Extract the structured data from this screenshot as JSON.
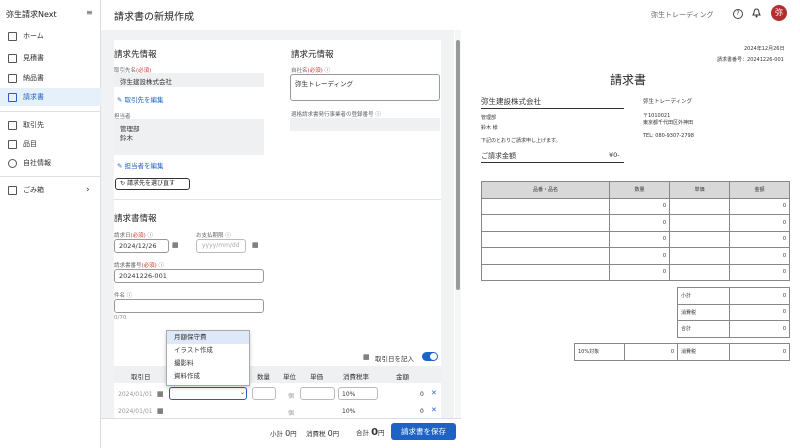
{
  "app": {
    "name": "弥生請求Next",
    "collapse_icon": "≡"
  },
  "sidebar": {
    "items": [
      {
        "label": "ホーム",
        "icon": "home-icon"
      },
      {
        "label": "見積書",
        "icon": "document-icon"
      },
      {
        "label": "納品書",
        "icon": "document-icon"
      },
      {
        "label": "請求書",
        "icon": "document-icon",
        "active": true
      },
      {
        "label": "取引先",
        "icon": "building-icon"
      },
      {
        "label": "品目",
        "icon": "box-icon"
      },
      {
        "label": "自社情報",
        "icon": "gear-icon"
      },
      {
        "label": "ごみ箱",
        "icon": "trash-icon"
      }
    ]
  },
  "header": {
    "title": "請求書の新規作成",
    "company": "弥生トレーディング",
    "avatar": "弥",
    "help": "?",
    "bell": "🔔"
  },
  "client": {
    "section": "請求先情報",
    "name_label": "取引先名",
    "required": "(必須)",
    "name": "弥生建設株式会社",
    "edit_link": "取引先を編集",
    "person_label": "担当者",
    "person_lines": [
      "管理部",
      "鈴木"
    ],
    "person_edit": "担当者を編集",
    "reselect": "請求先を選び直す"
  },
  "issuer": {
    "section": "請求元情報",
    "name_label": "自社名",
    "required": "(必須)",
    "name": "弥生トレーディング",
    "reg_label": "適格請求書発行事業者の登録番号"
  },
  "invoice": {
    "section": "請求書情報",
    "date_label": "請求日",
    "date": "2024/12/26",
    "due_label": "お支払期限",
    "due_placeholder": "yyyy/mm/dd",
    "number_label": "請求書番号",
    "number": "20241226-001",
    "subject_label": "件名",
    "counter": "0/70",
    "required": "(必須)"
  },
  "lines": {
    "date_toggle": "取引日を記入",
    "headers": [
      "取引日",
      "数量",
      "単位",
      "単価",
      "消費税率",
      "金額"
    ],
    "rows": [
      {
        "date": "2024/01/01",
        "unit": "個",
        "tax": "10%",
        "amount": "0"
      },
      {
        "date": "2024/01/01",
        "unit": "個",
        "tax": "10%",
        "amount": "0"
      }
    ],
    "dropdown": [
      "月額保守費",
      "イラスト作成",
      "撮影料",
      "資料作成"
    ]
  },
  "footer": {
    "subtotal_label": "小計",
    "subtotal": "0",
    "tax_label": "消費税",
    "tax": "0",
    "total_label": "合計",
    "total": "0",
    "yen": "円",
    "save": "請求書を保存"
  },
  "preview": {
    "date": "2024年12月26日",
    "number_label": "請求書番号：",
    "number": "20241226-001",
    "title": "請求書",
    "client": "弥生建設株式会社",
    "dept": "管理部",
    "person": "鈴木 様",
    "greeting": "下記のとおりご請求申し上げます。",
    "amount_label": "ご請求金額",
    "amount": "¥0-",
    "issuer": "弥生トレーディング",
    "zip": "〒1010021",
    "address": "東京都千代田区外神田",
    "tel": "TEL: 080-9307-2798",
    "headers": [
      "品番・品名",
      "数量",
      "単価",
      "金額"
    ],
    "row_vals": [
      "0",
      "0",
      "0",
      "0",
      "0"
    ],
    "subtotal_label": "小計",
    "tax_label": "消費税",
    "total_label": "合計",
    "rate_label": "10%対象",
    "rate_val": "0",
    "rate_tax_label": "消費税"
  }
}
